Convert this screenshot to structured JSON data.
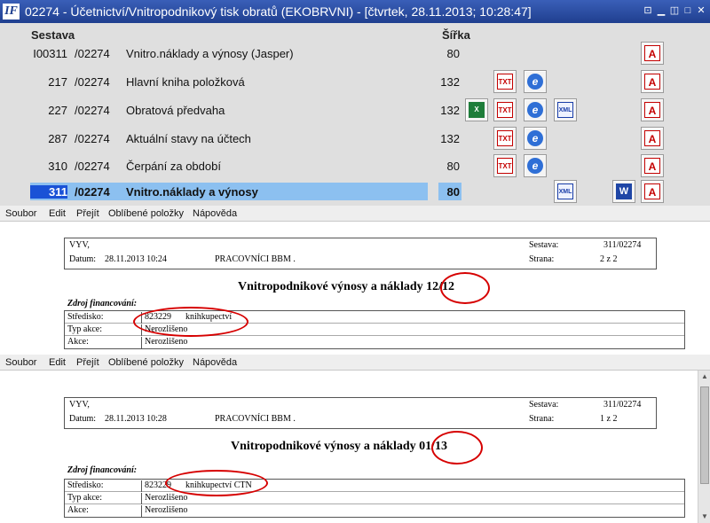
{
  "window": {
    "title": "02274 - Účetnictví/Vnitropodnikový tisk obratů (EKOBRVNI) - [čtvrtek, 28.11.2013; 10:28:47]",
    "app_icon_text": "IF"
  },
  "columns": {
    "report": "Sestava",
    "width": "Šířka"
  },
  "rows": [
    {
      "code": "I00311",
      "unit": "/02274",
      "name": "Vnitro.náklady a výnosy (Jasper)",
      "width": "80"
    },
    {
      "code": "217",
      "unit": "/02274",
      "name": "Hlavní kniha položková",
      "width": "132"
    },
    {
      "code": "227",
      "unit": "/02274",
      "name": "Obratová předvaha",
      "width": "132"
    },
    {
      "code": "287",
      "unit": "/02274",
      "name": "Aktuální stavy na účtech",
      "width": "132"
    },
    {
      "code": "310",
      "unit": "/02274",
      "name": "Čerpání za období",
      "width": "80"
    },
    {
      "code": "311",
      "unit": "/02274",
      "name": "Vnitro.náklady a výnosy",
      "width": "80",
      "selected": true
    }
  ],
  "icons": {
    "excel": "X",
    "txt": "TXT",
    "ie": "e",
    "xml": "XML",
    "word": "W",
    "pdf": "A"
  },
  "menu": [
    "Soubor",
    "Edit",
    "Přejít",
    "Oblíbené položky",
    "Nápověda"
  ],
  "report1": {
    "org": "VYV,",
    "date_label": "Datum:",
    "date": "28.11.2013 10:24",
    "group": "PRACOVNÍCI BBM .",
    "report_label": "Sestava:",
    "report_value": "311/02274",
    "page_label": "Strana:",
    "page_value": "2 z 2",
    "title": "Vnitropodnikové výnosy a náklady 12/12",
    "funding_label": "Zdroj financování:",
    "fields": [
      {
        "label": "Středisko:",
        "value": "823229",
        "value2": "knihkupectví"
      },
      {
        "label": "Typ akce:",
        "value": "Nerozlišeno",
        "value2": ""
      },
      {
        "label": "Akce:",
        "value": "Nerozlišeno",
        "value2": ""
      }
    ]
  },
  "report2": {
    "org": "VYV,",
    "date_label": "Datum:",
    "date": "28.11.2013 10:28",
    "group": "PRACOVNÍCI BBM .",
    "report_label": "Sestava:",
    "report_value": "311/02274",
    "page_label": "Strana:",
    "page_value": "1 z 2",
    "title": "Vnitropodnikové výnosy a náklady 01/13",
    "funding_label": "Zdroj financování:",
    "fields": [
      {
        "label": "Středisko:",
        "value": "823229",
        "value2": "knihkupectví CTN"
      },
      {
        "label": "Typ akce:",
        "value": "Nerozlišeno",
        "value2": ""
      },
      {
        "label": "Akce:",
        "value": "Nerozlišeno",
        "value2": ""
      }
    ]
  },
  "colors": {
    "titlebar": "#1f3f8f",
    "selection": "#8cc0f0",
    "selected_code": "#1a52d6",
    "annotation": "#d60000"
  }
}
